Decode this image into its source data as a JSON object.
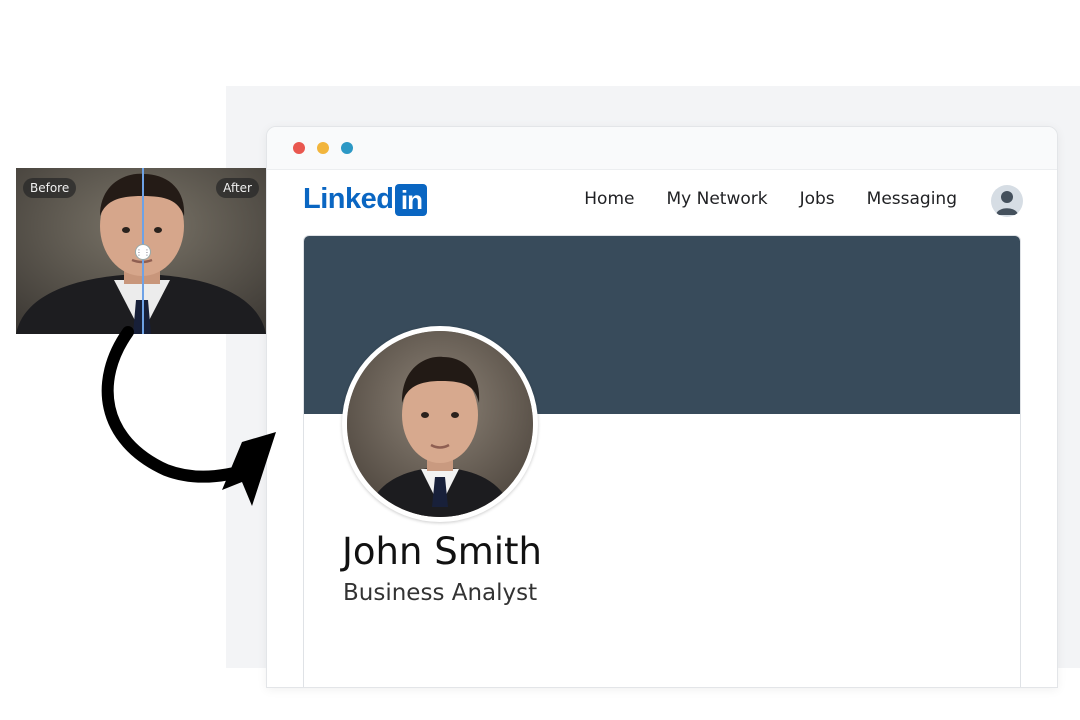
{
  "compare_widget": {
    "before_label": "Before",
    "after_label": "After"
  },
  "browser": {
    "dots": [
      "#e9574f",
      "#f2b53c",
      "#2c98c5"
    ]
  },
  "navbar": {
    "logo_text": "Linked",
    "logo_box": "in",
    "links": [
      "Home",
      "My Network",
      "Jobs",
      "Messaging"
    ]
  },
  "profile": {
    "name": "John Smith",
    "title": "Business Analyst",
    "banner_color": "#384b5b"
  },
  "colors": {
    "brand": "#0a66c2"
  }
}
